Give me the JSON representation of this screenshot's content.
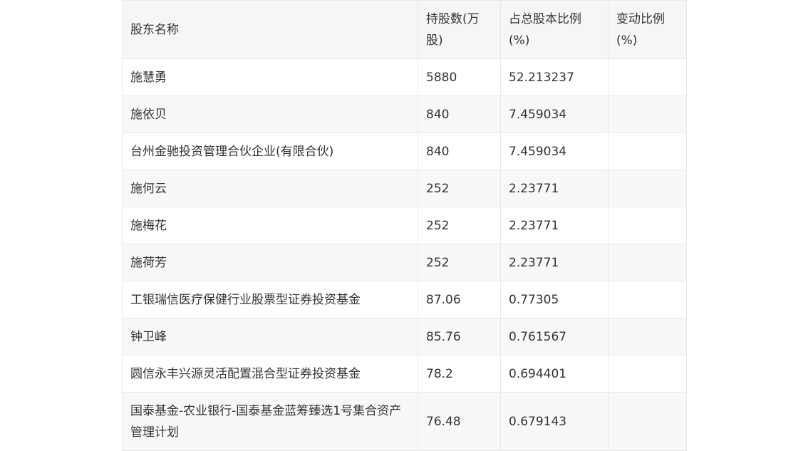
{
  "table": {
    "headers": [
      "股东名称",
      "持股数(万股)",
      "占总股本比例(%)",
      "变动比例(%)"
    ],
    "rows": [
      {
        "name": "施慧勇",
        "shares": "5880",
        "ratio": "52.213237",
        "change": ""
      },
      {
        "name": "施依贝",
        "shares": "840",
        "ratio": "7.459034",
        "change": ""
      },
      {
        "name": "台州金驰投资管理合伙企业(有限合伙)",
        "shares": "840",
        "ratio": "7.459034",
        "change": ""
      },
      {
        "name": "施何云",
        "shares": "252",
        "ratio": "2.23771",
        "change": ""
      },
      {
        "name": "施梅花",
        "shares": "252",
        "ratio": "2.23771",
        "change": ""
      },
      {
        "name": "施荷芳",
        "shares": "252",
        "ratio": "2.23771",
        "change": ""
      },
      {
        "name": "工银瑞信医疗保健行业股票型证券投资基金",
        "shares": "87.06",
        "ratio": "0.77305",
        "change": ""
      },
      {
        "name": "钟卫峰",
        "shares": "85.76",
        "ratio": "0.761567",
        "change": ""
      },
      {
        "name": "圆信永丰兴源灵活配置混合型证券投资基金",
        "shares": "78.2",
        "ratio": "0.694401",
        "change": ""
      },
      {
        "name": "国泰基金-农业银行-国泰基金蓝筹臻选1号集合资产管理计划",
        "shares": "76.48",
        "ratio": "0.679143",
        "change": ""
      }
    ]
  }
}
